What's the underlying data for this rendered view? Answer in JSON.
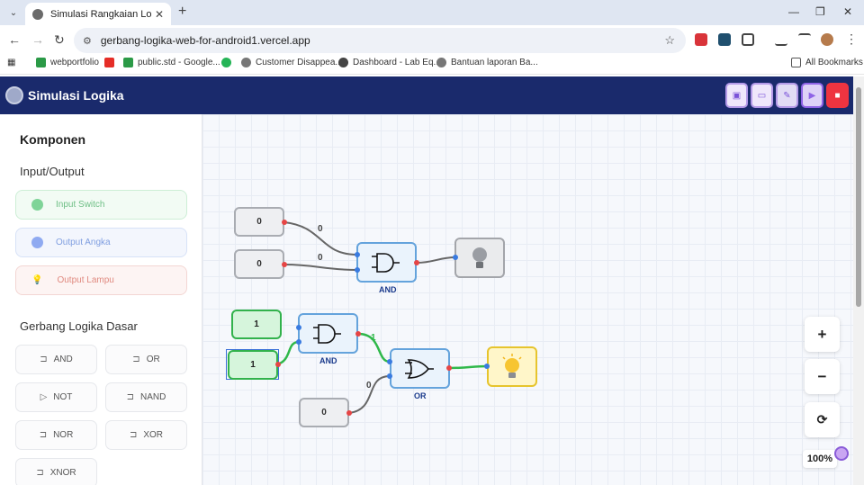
{
  "browser": {
    "tab_title": "Simulasi Rangkaian Logika",
    "url": "gerbang-logika-web-for-android1.vercel.app",
    "bookmarks": [
      "webportfolio",
      "public.std - Google...",
      "Customer Disappea...",
      "Dashboard - Lab Eq...",
      "Bantuan laporan Ba..."
    ],
    "all_bookmarks": "All Bookmarks"
  },
  "app": {
    "title": "Simulasi Logika"
  },
  "sidebar": {
    "heading": "Komponen",
    "io_heading": "Input/Output",
    "io_items": [
      "Input Switch",
      "Output Angka",
      "Output Lampu"
    ],
    "gates_heading": "Gerbang Logika Dasar",
    "gates": [
      "AND",
      "OR",
      "NOT",
      "NAND",
      "NOR",
      "XOR",
      "XNOR"
    ]
  },
  "canvas": {
    "switches": [
      "0",
      "0",
      "1",
      "1",
      "0"
    ],
    "gate_labels": [
      "AND",
      "AND",
      "OR"
    ],
    "wire_labels": [
      "0",
      "0",
      "1",
      "0"
    ]
  },
  "zoom": {
    "in": "+",
    "out": "−",
    "reset": "⟳",
    "level": "100%"
  },
  "colors": {
    "appbar": "#1a2a6c",
    "wire_active": "#2fb84a",
    "wire_inactive": "#666666",
    "pin_output": "#e64545",
    "pin_input": "#3a7be0"
  }
}
